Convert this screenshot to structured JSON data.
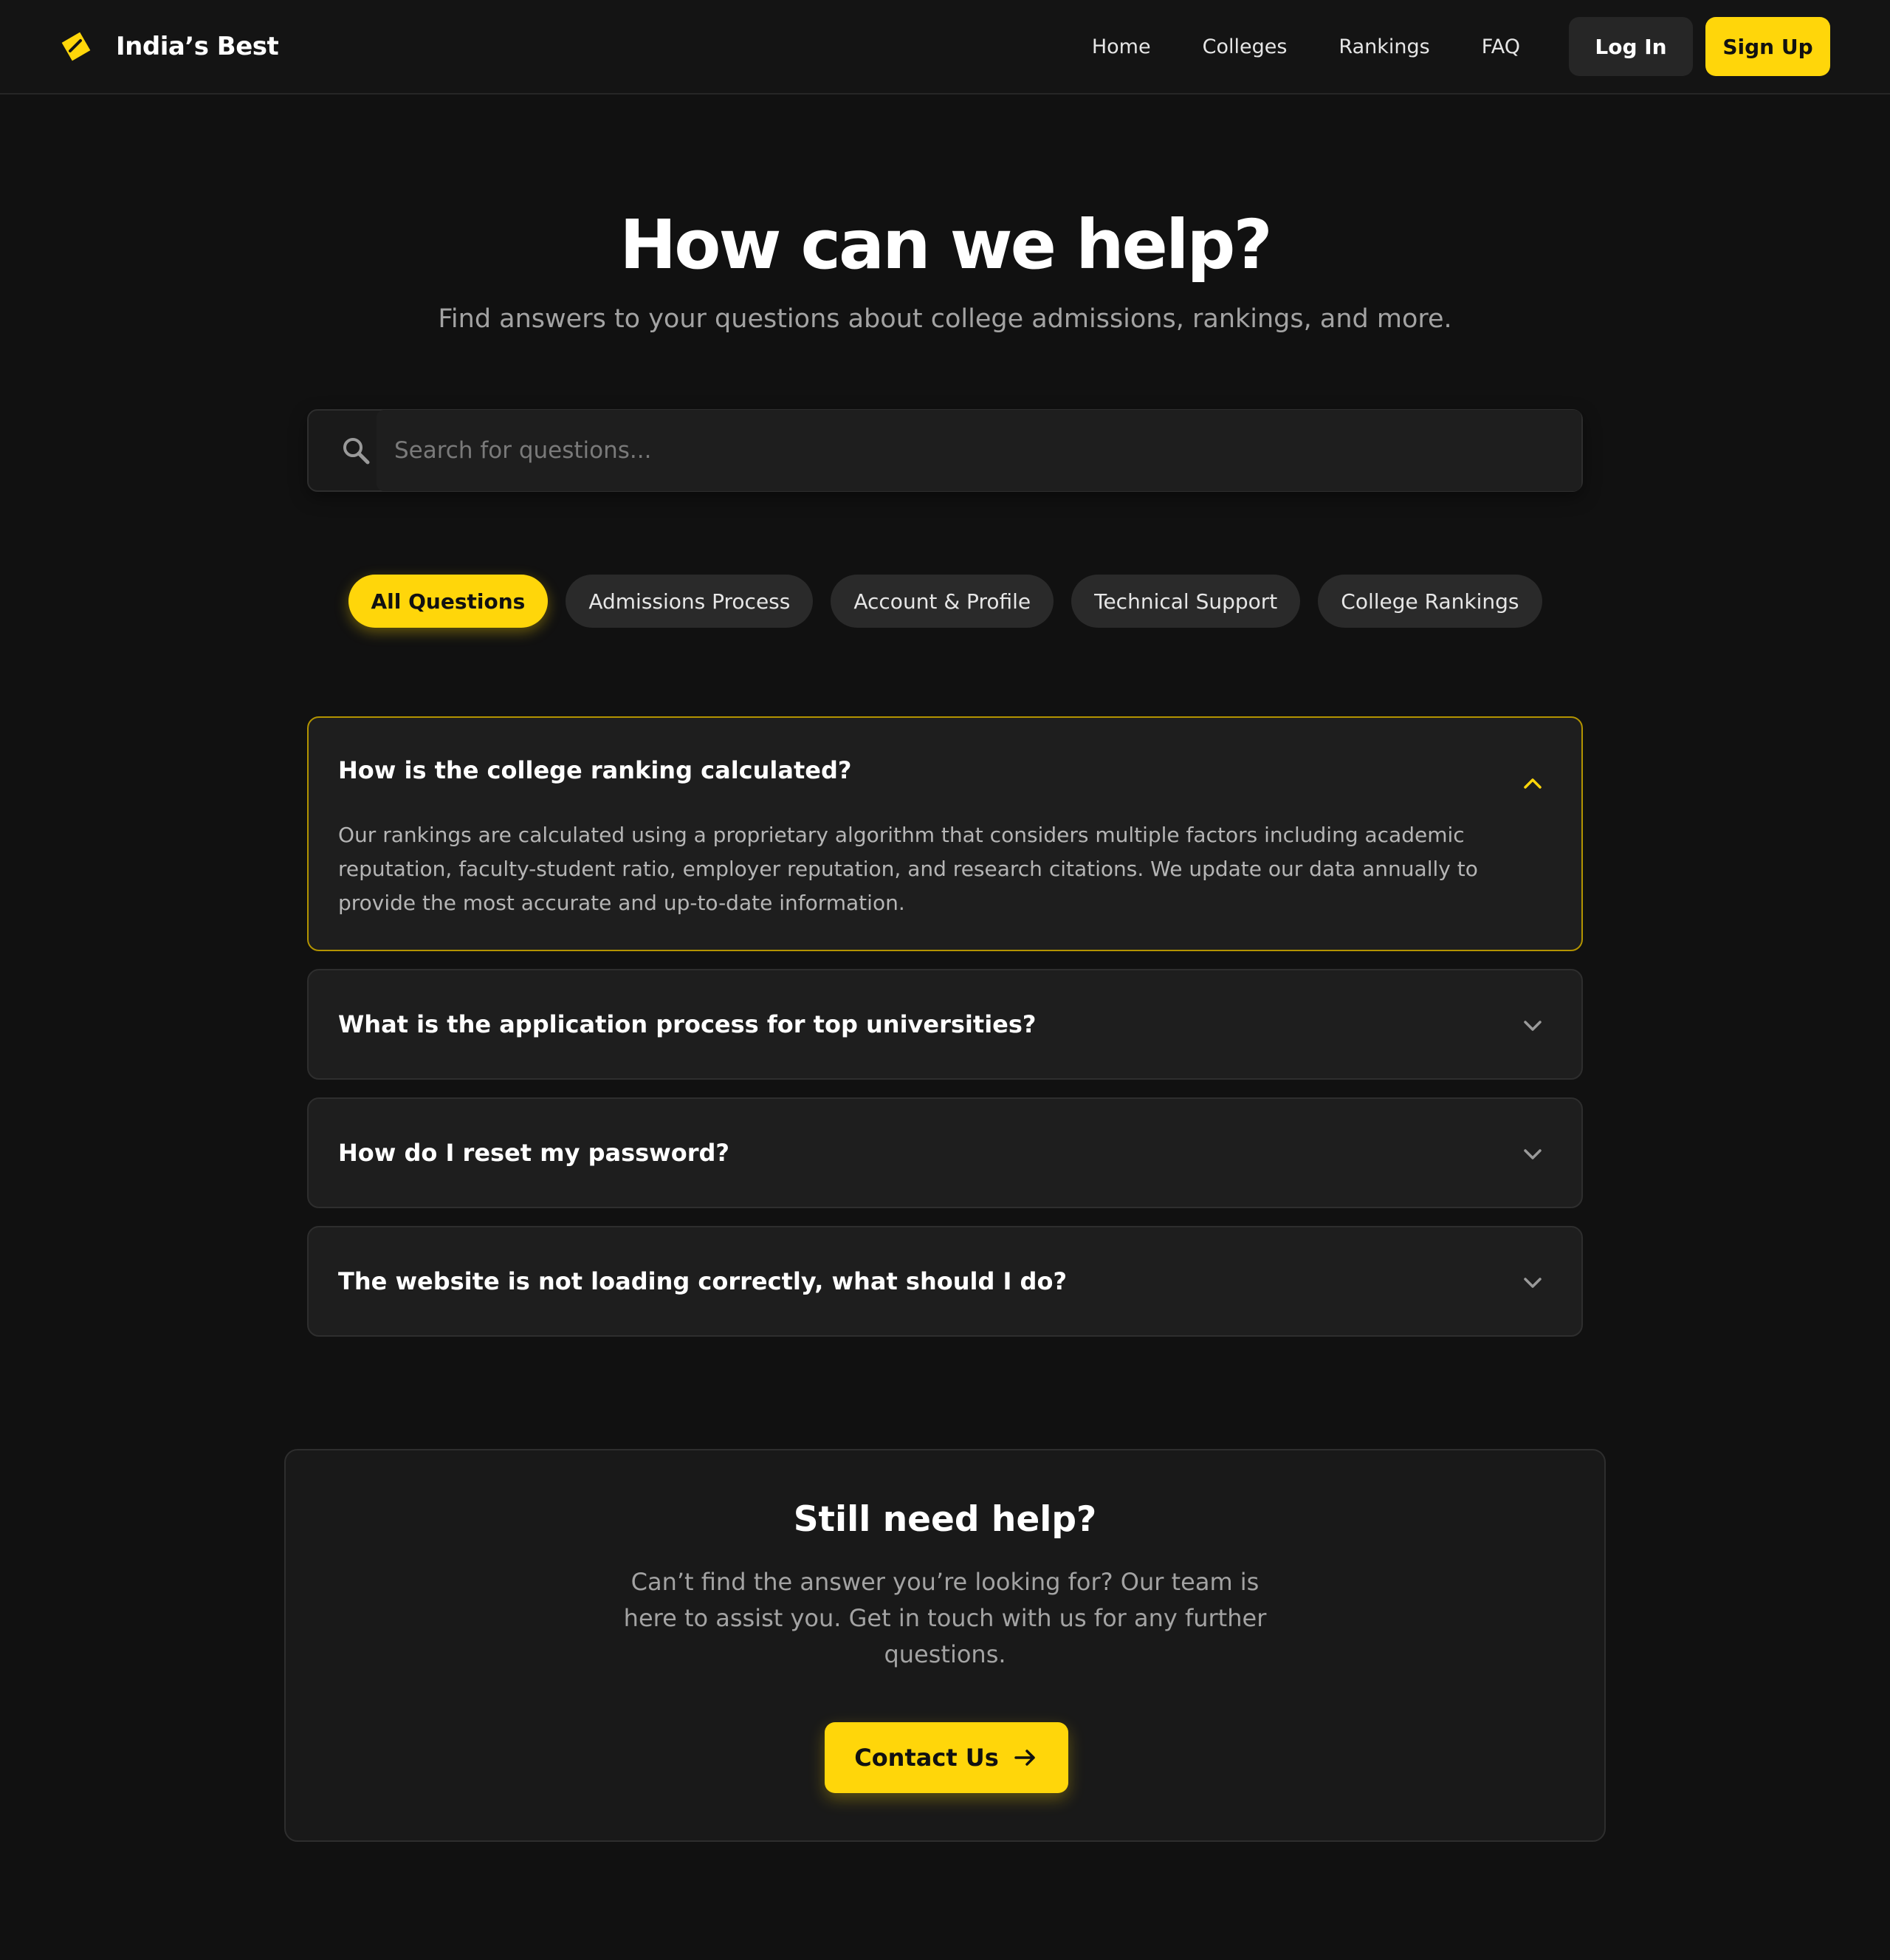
{
  "header": {
    "brand": "India’s Best",
    "nav": [
      "Home",
      "Colleges",
      "Rankings",
      "FAQ"
    ],
    "login_label": "Log In",
    "signup_label": "Sign Up"
  },
  "hero": {
    "title": "How can we help?",
    "subtitle": "Find answers to your questions about college admissions, rankings, and more."
  },
  "search": {
    "placeholder": "Search for questions...",
    "value": ""
  },
  "filters": [
    {
      "label": "All Questions",
      "active": true
    },
    {
      "label": "Admissions Process",
      "active": false
    },
    {
      "label": "Account & Profile",
      "active": false
    },
    {
      "label": "Technical Support",
      "active": false
    },
    {
      "label": "College Rankings",
      "active": false
    }
  ],
  "faqs": [
    {
      "question": "How is the college ranking calculated?",
      "answer": "Our rankings are calculated using a proprietary algorithm that considers multiple factors including academic reputation, faculty-student ratio, employer reputation, and research citations. We update our data annually to provide the most accurate and up-to-date information.",
      "open": true
    },
    {
      "question": "What is the application process for top universities?",
      "open": false
    },
    {
      "question": "How do I reset my password?",
      "open": false
    },
    {
      "question": "The website is not loading correctly, what should I do?",
      "open": false
    }
  ],
  "help": {
    "title": "Still need help?",
    "text": "Can’t find the answer you’re looking for? Our team is here to assist you. Get in touch with us for any further questions.",
    "button_label": "Contact Us"
  },
  "colors": {
    "accent": "#ffd60a",
    "background": "#111111",
    "card": "#1e1e1e"
  },
  "icons": {
    "logo": "tag-logo-icon",
    "search": "search-icon",
    "chevron_up": "chevron-up-icon",
    "chevron_down": "chevron-down-icon",
    "arrow": "arrow-right-icon"
  }
}
